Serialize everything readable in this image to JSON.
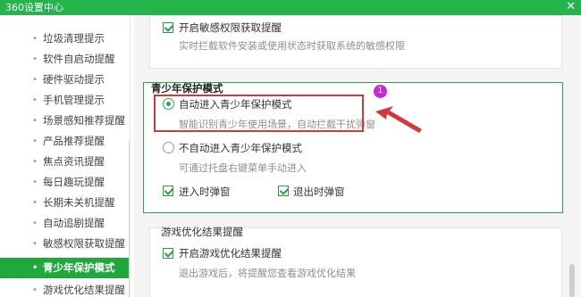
{
  "window": {
    "title": "360设置中心",
    "close_icon": "✕"
  },
  "sidebar": {
    "items": [
      {
        "label": "垃圾清理提示",
        "active": false
      },
      {
        "label": "软件自启动提醒",
        "active": false
      },
      {
        "label": "硬件驱动提示",
        "active": false
      },
      {
        "label": "手机管理提示",
        "active": false
      },
      {
        "label": "场景感知推荐提醒",
        "active": false
      },
      {
        "label": "产品推荐提醒",
        "active": false
      },
      {
        "label": "焦点资讯提醒",
        "active": false
      },
      {
        "label": "每日趣玩提醒",
        "active": false
      },
      {
        "label": "长期未关机提醒",
        "active": false
      },
      {
        "label": "自动追剧提醒",
        "active": false
      },
      {
        "label": "敏感权限获取提醒",
        "active": false
      },
      {
        "label": "青少年保护模式",
        "active": true
      },
      {
        "label": "游戏优化结果提醒",
        "active": false
      }
    ],
    "dot": "•"
  },
  "sensitive": {
    "checkbox_label": "开启敏感权限获取提醒",
    "description": "实时拦截软件安装或使用状态时获取系统的敏感权限"
  },
  "youth": {
    "title": "青少年保护模式",
    "option_auto": {
      "label": "自动进入青少年保护模式",
      "description": "智能识别青少年使用场景，自动拦截干扰弹窗",
      "selected": true
    },
    "option_manual": {
      "label": "不自动进入青少年保护模式",
      "description": "可通过托盘右键菜单手动进入",
      "selected": false
    },
    "enter_popup_label": "进入时弹窗",
    "exit_popup_label": "退出时弹窗"
  },
  "game": {
    "title": "游戏优化结果提醒",
    "checkbox_label": "开启游戏优化结果提醒",
    "description": "退出游戏后，将提醒您查看游戏优化结果"
  },
  "annotation": {
    "badge_number": "1",
    "highlight_color": "#d23a3a",
    "arrow_color": "#d23a3a",
    "badge_color": "#c62bd4"
  },
  "colors": {
    "brand_green": "#25b34b",
    "active_green": "#21a83d",
    "border_green": "#2ea54a"
  }
}
